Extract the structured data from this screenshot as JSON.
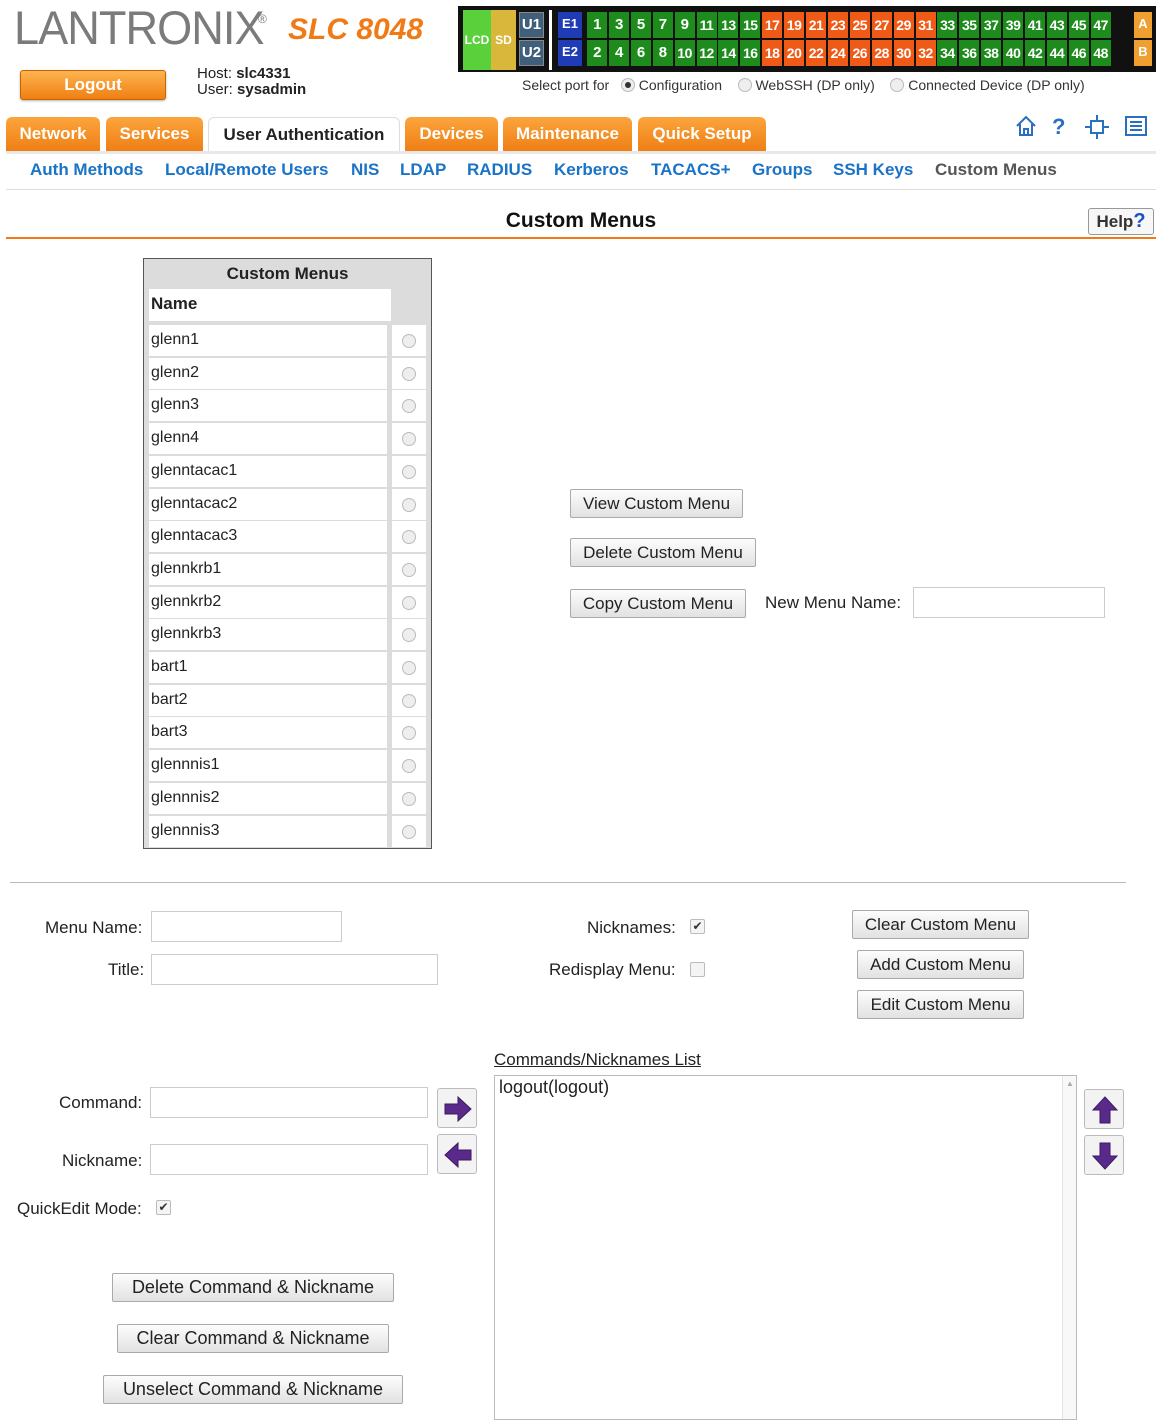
{
  "header": {
    "brand": "LANTRONIX",
    "brand_mark": "®",
    "model": "SLC 8048",
    "logout_label": "Logout",
    "host_label": "Host:",
    "host_value": "slc4331",
    "user_label": "User:",
    "user_value": "sysadmin"
  },
  "port_panel": {
    "lcd": "LCD",
    "sd": "SD",
    "u1": "U1",
    "u2": "U2",
    "e1": "E1",
    "e2": "E2",
    "a": "A",
    "b": "B",
    "top_ports": [
      "1",
      "3",
      "5",
      "7",
      "9",
      "11",
      "13",
      "15",
      "17",
      "19",
      "21",
      "23",
      "25",
      "27",
      "29",
      "31",
      "33",
      "35",
      "37",
      "39",
      "41",
      "43",
      "45",
      "47"
    ],
    "bottom_ports": [
      "2",
      "4",
      "6",
      "8",
      "10",
      "12",
      "14",
      "16",
      "18",
      "20",
      "22",
      "24",
      "26",
      "28",
      "30",
      "32",
      "34",
      "36",
      "38",
      "40",
      "42",
      "44",
      "46",
      "48"
    ],
    "top_colors": [
      "green",
      "green",
      "green",
      "green",
      "green",
      "green",
      "green",
      "green",
      "orange",
      "orange",
      "orange",
      "orange",
      "orange",
      "orange",
      "orange",
      "orange",
      "green",
      "green",
      "green",
      "green",
      "green",
      "green",
      "green",
      "green"
    ],
    "bottom_colors": [
      "green",
      "green",
      "green",
      "green",
      "green",
      "green",
      "green",
      "green",
      "orange",
      "orange",
      "orange",
      "orange",
      "orange",
      "orange",
      "orange",
      "orange",
      "green",
      "green",
      "green",
      "green",
      "green",
      "green",
      "green",
      "green"
    ],
    "green_color": "#1d8c1d",
    "orange_color": "#f05a17"
  },
  "port_select": {
    "label": "Select port for",
    "options": [
      "Configuration",
      "WebSSH (DP only)",
      "Connected Device (DP only)"
    ],
    "selected": "Configuration"
  },
  "tabs": [
    {
      "label": "Network",
      "active": false
    },
    {
      "label": "Services",
      "active": false
    },
    {
      "label": "User Authentication",
      "active": true
    },
    {
      "label": "Devices",
      "active": false
    },
    {
      "label": "Maintenance",
      "active": false
    },
    {
      "label": "Quick Setup",
      "active": false
    }
  ],
  "header_icons": [
    "home-icon",
    "help-icon",
    "sitemap-icon",
    "logs-icon"
  ],
  "subnav": [
    "Auth Methods",
    "Local/Remote Users",
    "NIS",
    "LDAP",
    "RADIUS",
    "Kerberos",
    "TACACS+",
    "Groups",
    "SSH Keys",
    "Custom Menus"
  ],
  "subnav_current": "Custom Menus",
  "page": {
    "title": "Custom Menus",
    "help_label": "Help",
    "help_mark": "?"
  },
  "menus_table": {
    "title": "Custom Menus",
    "column_name": "Name",
    "rows": [
      "glenn1",
      "glenn2",
      "glenn3",
      "glenn4",
      "glenntacac1",
      "glenntacac2",
      "glenntacac3",
      "glennkrb1",
      "glennkrb2",
      "glennkrb3",
      "bart1",
      "bart2",
      "bart3",
      "glennnis1",
      "glennnis2",
      "glennnis3"
    ]
  },
  "menu_actions": {
    "view": "View Custom Menu",
    "delete": "Delete Custom Menu",
    "copy": "Copy Custom Menu",
    "new_name_label": "New Menu Name:",
    "new_name_value": ""
  },
  "form": {
    "menu_name_label": "Menu Name:",
    "menu_name_value": "",
    "title_label": "Title:",
    "title_value": "",
    "nicknames_label": "Nicknames:",
    "nicknames_checked": true,
    "redisplay_label": "Redisplay Menu:",
    "redisplay_checked": false,
    "clear_menu": "Clear Custom Menu",
    "add_menu": "Add Custom Menu",
    "edit_menu": "Edit Custom Menu",
    "command_label": "Command:",
    "command_value": "",
    "nickname_label": "Nickname:",
    "nickname_value": "",
    "quickedit_label": "QuickEdit Mode:",
    "quickedit_checked": true,
    "delete_cmd": "Delete Command & Nickname",
    "clear_cmd": "Clear Command & Nickname",
    "unselect_cmd": "Unselect Command & Nickname",
    "list_label": "Commands/Nicknames List",
    "list_items": [
      "logout(logout)"
    ],
    "check_mark": "✔",
    "arrow_color": "#5a2a8a"
  }
}
